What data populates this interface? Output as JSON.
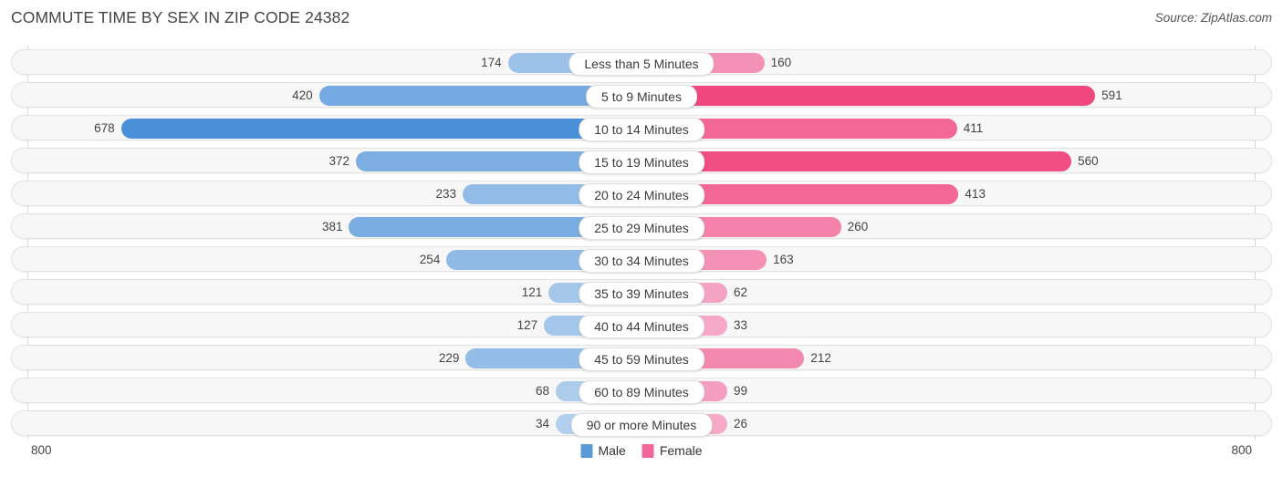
{
  "header": {
    "title": "COMMUTE TIME BY SEX IN ZIP CODE 24382",
    "source": "Source: ZipAtlas.com"
  },
  "axis": {
    "left_tick": "800",
    "right_tick": "800",
    "max": 800
  },
  "legend": {
    "items": [
      {
        "label": "Male",
        "color": "#5b9bd5"
      },
      {
        "label": "Female",
        "color": "#f2679a"
      }
    ]
  },
  "colors": {
    "male_strong": "#4a90d9",
    "male_weak": "#b8d3ee",
    "female_strong": "#f0487e",
    "female_weak": "#f6aecb",
    "track": "#f7f7f7",
    "track_border": "#e2e2e2"
  },
  "chart_data": {
    "type": "bar",
    "subtype": "diverging-bar",
    "title": "COMMUTE TIME BY SEX IN ZIP CODE 24382",
    "xlabel": "",
    "ylabel": "",
    "xlim": [
      800,
      800
    ],
    "grid": false,
    "legend_position": "bottom-center",
    "categories": [
      "Less than 5 Minutes",
      "5 to 9 Minutes",
      "10 to 14 Minutes",
      "15 to 19 Minutes",
      "20 to 24 Minutes",
      "25 to 29 Minutes",
      "30 to 34 Minutes",
      "35 to 39 Minutes",
      "40 to 44 Minutes",
      "45 to 59 Minutes",
      "60 to 89 Minutes",
      "90 or more Minutes"
    ],
    "series": [
      {
        "name": "Male",
        "side": "left",
        "values": [
          174,
          420,
          678,
          372,
          233,
          381,
          254,
          121,
          127,
          229,
          68,
          34
        ]
      },
      {
        "name": "Female",
        "side": "right",
        "values": [
          160,
          591,
          411,
          560,
          413,
          260,
          163,
          62,
          33,
          212,
          99,
          26
        ]
      }
    ]
  }
}
